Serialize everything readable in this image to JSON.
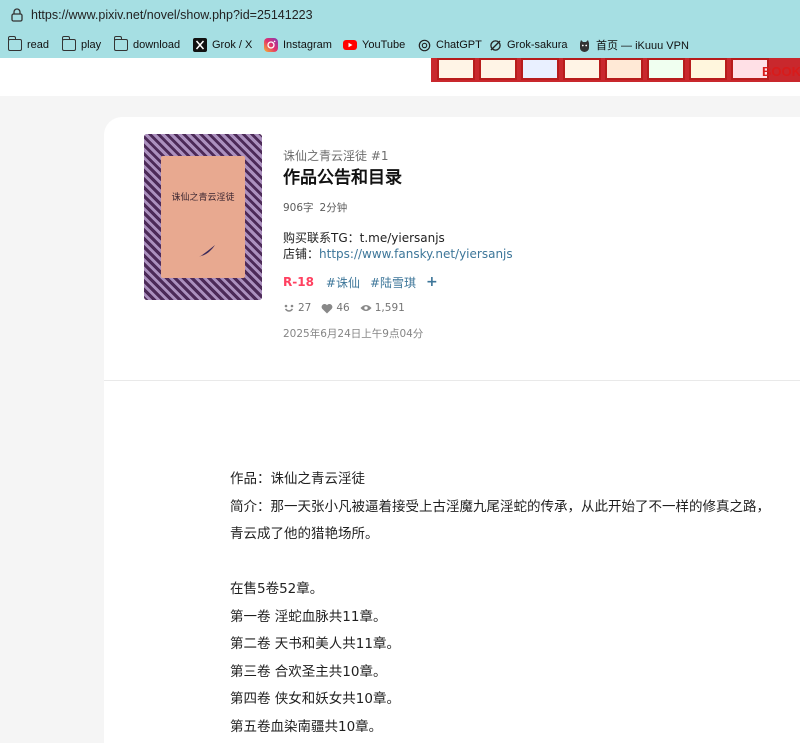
{
  "browser": {
    "url": "https://www.pixiv.net/novel/show.php?id=25141223"
  },
  "bookmarks": [
    {
      "label": "read",
      "icon": "folder-icon"
    },
    {
      "label": "play",
      "icon": "folder-icon"
    },
    {
      "label": "download",
      "icon": "folder-icon"
    },
    {
      "label": "Grok / X",
      "icon": "x-logo-icon"
    },
    {
      "label": "Instagram",
      "icon": "instagram-icon"
    },
    {
      "label": "YouTube",
      "icon": "youtube-icon"
    },
    {
      "label": "ChatGPT",
      "icon": "chatgpt-icon"
    },
    {
      "label": "Grok-sakura",
      "icon": "grok-icon"
    },
    {
      "label": "首页 — iKuuu VPN",
      "icon": "cat-icon"
    }
  ],
  "banner": {
    "text": "BOOK"
  },
  "novel": {
    "cover_title": "诛仙之青云淫徒",
    "series": "诛仙之青云淫徒 #1",
    "title": "作品公告和目录",
    "word_count": "906字",
    "read_time": "2分钟",
    "caption_line1": "购买联系TG：t.me/yiersanjs",
    "caption_line2_prefix": "店铺：",
    "caption_line2_link": "https://www.fansky.net/yiersanjs",
    "tags": {
      "rating": "R-18",
      "items": [
        "#诛仙",
        "#陆雪琪"
      ],
      "add": "+"
    },
    "reactions": {
      "likes": "27",
      "bookmarks": "46",
      "views": "1,591"
    },
    "date": "2025年6月24日上午9点04分"
  },
  "body": {
    "lines": [
      "作品：诛仙之青云淫徒",
      "简介：那一天张小凡被逼着接受上古淫魔九尾淫蛇的传承，从此开始了不一样的修真之路，青云成了他的猎艳场所。",
      "",
      "在售5卷52章。",
      "第一卷 淫蛇血脉共11章。",
      "第二卷 天书和美人共11章。",
      "第三卷 合欢圣主共10章。",
      "第四卷 侠女和妖女共10章。",
      "第五卷血染南疆共10章。"
    ]
  },
  "colors": {
    "browser_bar": "#a6dfe3",
    "link": "#3d7699",
    "r18": "#ff4060"
  }
}
